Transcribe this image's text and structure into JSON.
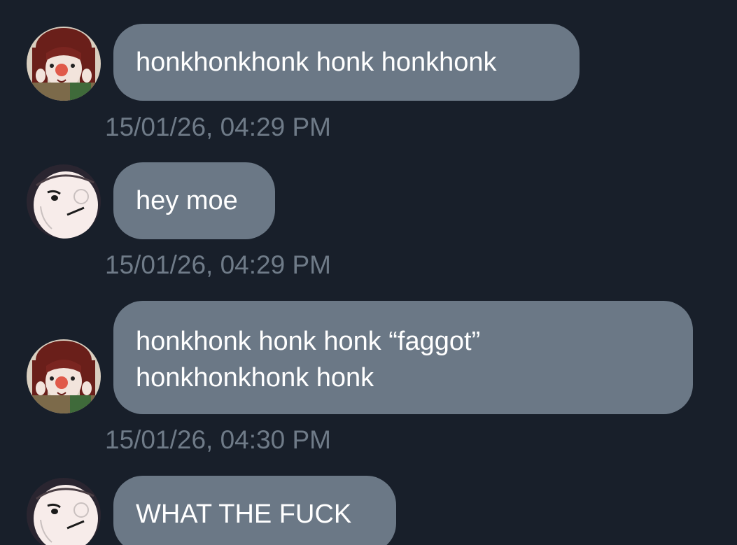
{
  "messages": [
    {
      "sender": "clown",
      "text": "honkhonkhonk honk honkhonk",
      "time": "15/01/26, 04:29 PM"
    },
    {
      "sender": "moe",
      "text": "hey moe",
      "time": "15/01/26, 04:29 PM"
    },
    {
      "sender": "clown",
      "text": "honkhonk honk honk “faggot” honkhonkhonk honk",
      "time": "15/01/26, 04:30 PM"
    },
    {
      "sender": "moe",
      "text": "WHAT THE FUCK",
      "time": ""
    }
  ],
  "colors": {
    "background": "#181f2a",
    "bubble": "#6b7886",
    "timestamp": "#6f7b88"
  }
}
